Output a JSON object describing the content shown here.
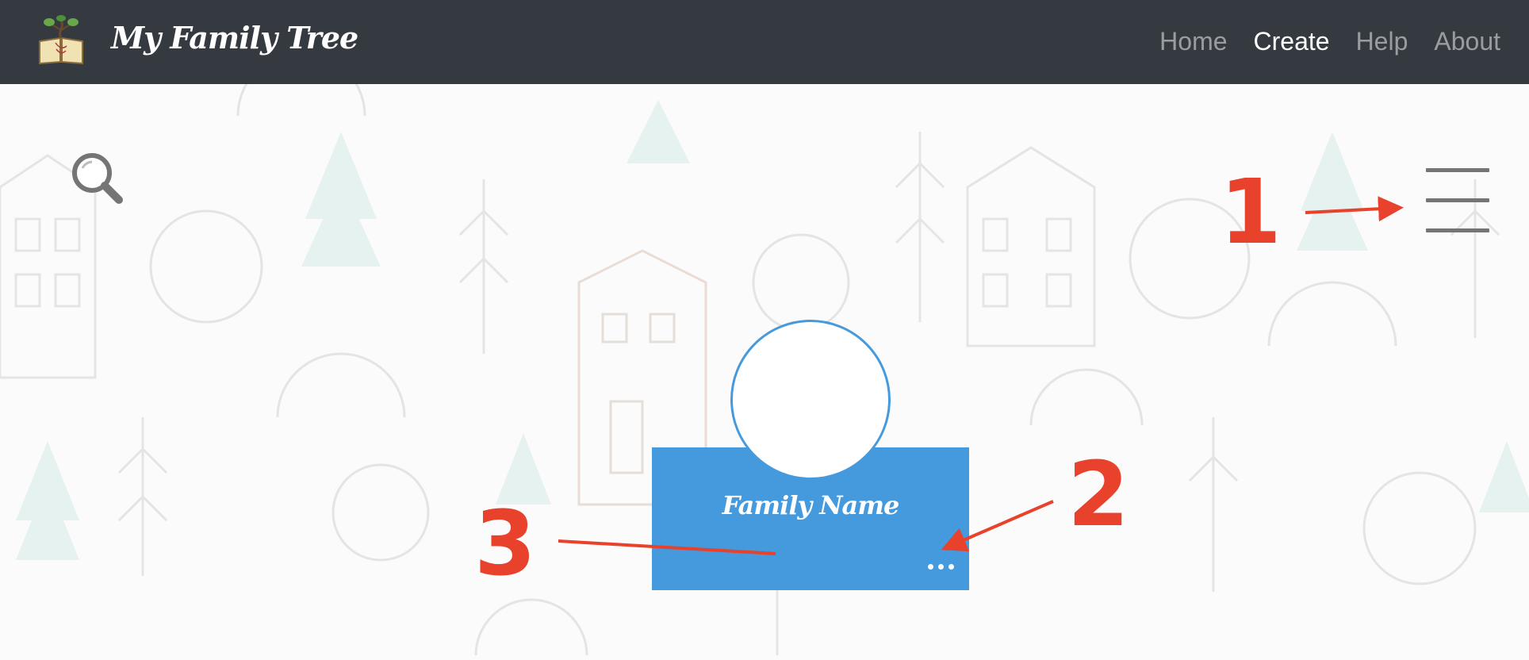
{
  "navbar": {
    "brand_title": "My Family Tree",
    "links": [
      {
        "label": "Home",
        "active": false
      },
      {
        "label": "Create",
        "active": true
      },
      {
        "label": "Help",
        "active": false
      },
      {
        "label": "About",
        "active": false
      }
    ]
  },
  "icons": {
    "logo": "book-tree-logo-icon",
    "search": "magnifier-icon",
    "menu": "hamburger-menu-icon",
    "more": "more-horizontal-icon"
  },
  "family_node": {
    "name": "Family Name"
  },
  "annotations": [
    "1",
    "2",
    "3"
  ],
  "colors": {
    "navbar_bg": "#343a40",
    "node_blue": "#4599dd",
    "annotation_red": "#e8412c",
    "icon_gray": "#757575"
  }
}
